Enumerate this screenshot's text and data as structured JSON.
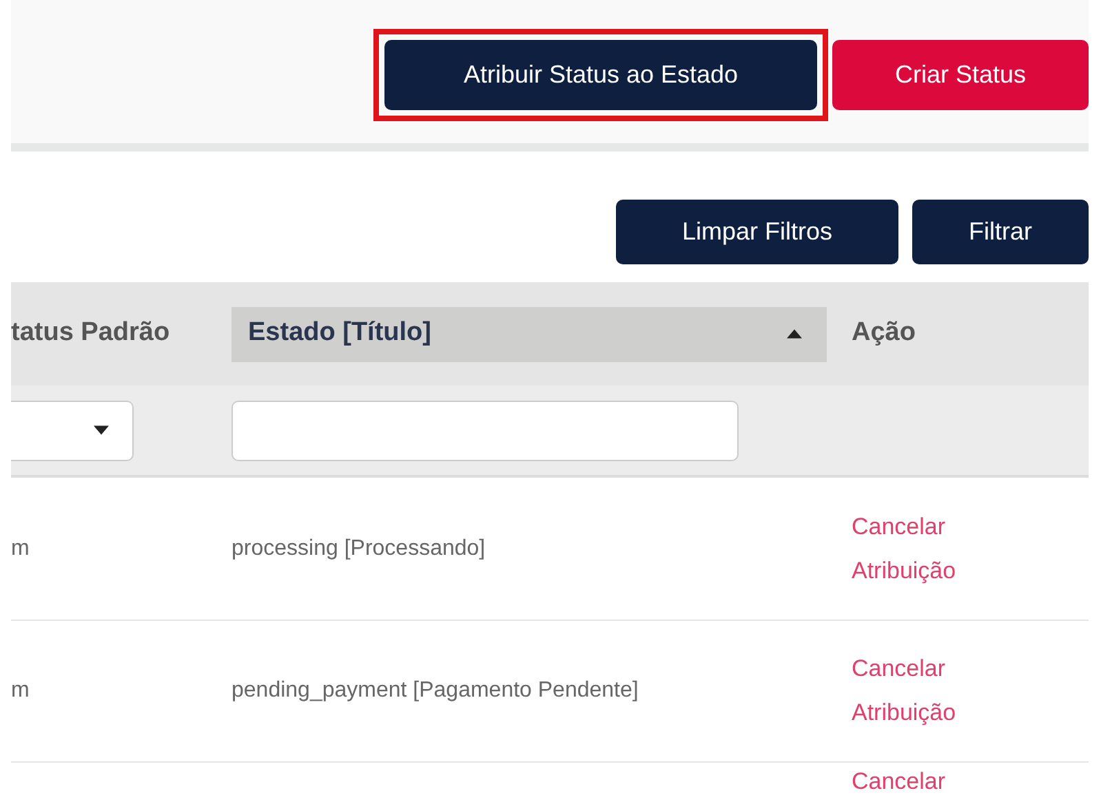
{
  "header_buttons": [
    {
      "label": "Atribuir Status ao Estado",
      "kind": "primary",
      "highlighted": true
    },
    {
      "label": "Criar Status",
      "kind": "danger",
      "highlighted": false
    }
  ],
  "filter_buttons": [
    "Limpar Filtros",
    "Filtrar"
  ],
  "table": {
    "columns": [
      {
        "label": "tatus Padrão",
        "sorted": false
      },
      {
        "label": "Estado [Título]",
        "sorted": true
      },
      {
        "label": "Ação",
        "sorted": false
      }
    ],
    "filters": [
      {
        "kind": "select"
      },
      {
        "kind": "text"
      },
      {
        "kind": "none"
      }
    ],
    "rows": [
      {
        "column_1": "m",
        "state": "processing [Processando]",
        "action": "Cancelar Atribuição"
      },
      {
        "column_1": "m",
        "state": "pending_payment [Pagamento Pendente]",
        "action": "Cancelar Atribuição"
      },
      {
        "action": "Cancelar"
      }
    ]
  }
}
